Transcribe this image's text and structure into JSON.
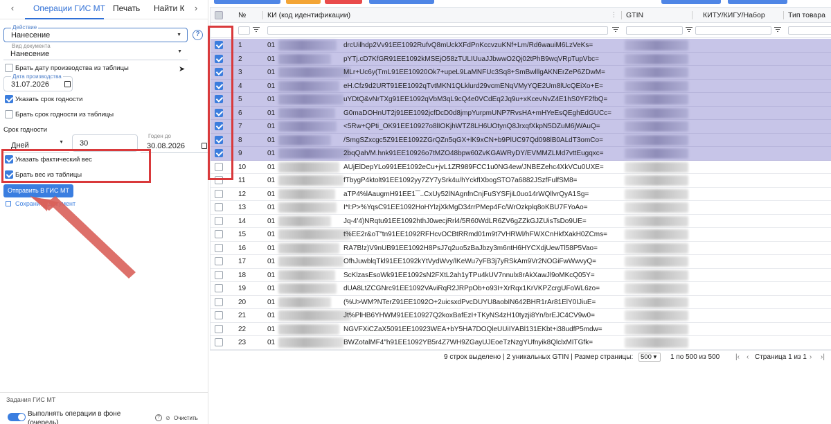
{
  "tabs": {
    "left_arrow": "‹",
    "items": [
      {
        "label": "Операции ГИС МТ",
        "active": true
      },
      {
        "label": "Печать",
        "active": false
      },
      {
        "label": "Найти КМ",
        "active": false
      }
    ],
    "right_arrow": "›"
  },
  "form": {
    "action_label": "Действие",
    "action_value": "Нанесение",
    "doc_type_label": "Вид документа",
    "doc_type_value": "Нанесение",
    "prod_date_from_table": "Брать дату производства из таблицы",
    "prod_date_label": "Дата производства",
    "prod_date_value": "31.07.2026",
    "expiry_specify": "Указать срок годности",
    "expiry_from_table": "Брать срок годности из таблицы",
    "expiry_section": "Срок годности",
    "expiry_unit": "Дней",
    "expiry_amount": "30",
    "valid_until_label": "Годен до",
    "valid_until_value": "30.08.2026",
    "actual_weight": "Указать фактический вес",
    "weight_from_table": "Брать вес из таблицы",
    "send_button": "Отправить В ГИС МТ",
    "save_button": "Сохранить Документ"
  },
  "tasks": {
    "title": "Задания ГИС МТ",
    "background_ops": "Выполнять операции в фоне (очередь)",
    "clear": "Очистить"
  },
  "grid": {
    "headers": {
      "num": "№",
      "ki": "КИ (код идентификации)",
      "gtin": "GTIN",
      "kitu": "КИТУ/КИГУ/Набор",
      "type": "Тип товара"
    },
    "rows": [
      {
        "n": "1",
        "pre": "01",
        "tail": "drcUilhdp2Vv91EE1092RufvQ8mUckXFdPnKccvzuKNf+Lm/Rd6wauiM6LzVeKs=",
        "sel": true
      },
      {
        "n": "2",
        "pre": "01",
        "tail": "pYTj.cD7KfGR91EE1092kMSEjO58zTULIUuaJJbwwO2Qj02tPhB9wqVRpTupVbc=",
        "sel": true
      },
      {
        "n": "3",
        "pre": "01",
        "tail": "MLr+Uc6y(TmL91EE10920Ok7+upeL9LaMNFUc3Sq8+SmBwlllgAKNErZeP6ZDwM=",
        "sel": true
      },
      {
        "n": "4",
        "pre": "01",
        "tail": "eH.Cfz9d2URT91EE1092qTvtMKN1QLklurd29vcmENqVMyYQE2Um8lUcQEiXo+E=",
        "sel": true
      },
      {
        "n": "5",
        "pre": "01",
        "tail": "uYDtQ&vNrTXg91EE1092qVbM3qL9cQ4e0VCdEq2Jq9u+xKcevNvZ4E1hS0YF2fbQ=",
        "sel": true
      },
      {
        "n": "6",
        "pre": "01",
        "tail": "G0maDOHnUT2j91EE1092jcfDcD0d8jmpYurpmUNP7RvsHA+mHYeEsQEghEdGUCc=",
        "sel": true
      },
      {
        "n": "7",
        "pre": "01",
        "tail": "<5Rw+QPti_OK91EE10927o8lIOKjhWTZ8LH6UOtynQ8JrxqfXkpN5DZuM6jWAuQ=",
        "sel": true
      },
      {
        "n": "8",
        "pre": "01",
        "tail": "/SmgSZxcgc5Z91EE1092ZGrQZn5qGX+lK9xCN+b9PlUC97Qd098lB0ALdT3omCo=",
        "sel": true
      },
      {
        "n": "9",
        "pre": "01",
        "tail": "2bqQah/M.hnk91EE10926o7tMZO48bpw60ZvKGAWRyDY/EVMMZLMd7vttEugqxc=",
        "sel": true
      },
      {
        "n": "10",
        "pre": "01",
        "tail": "AUjElDepYLo991EE1092eCu+jvL1ZR989FCC1u0NG4ew/JNBEZehc4XkVCu0UXE=",
        "sel": false
      },
      {
        "n": "11",
        "pre": "01",
        "tail": "fTbygP4ktolt91EE1092yy7ZY7ySrk4u/hYckfIXbogSTO7a6882JSzfFulfSM8=",
        "sel": false
      },
      {
        "n": "12",
        "pre": "01",
        "tail": "aTP4%lAaugmH91EE1‾‾..CxUy52lNAgnfnCnjFuSYSFjiL0uo14rWQllvrQyA1Sg=",
        "sel": false
      },
      {
        "n": "13",
        "pre": "01",
        "tail": "I*I:P>%YqsC91EE1092HoHYlzjXkMgD34rrPMep4Fc/WrOzkplq8oKBU7FYoAo=",
        "sel": false
      },
      {
        "n": "14",
        "pre": "01",
        "tail": "Jq-4'4)NRqtu91EE1092hthJ0wecjRrl4/5R60WdLR6ZV6gZZkGJZUisTsDo9UE=",
        "sel": false
      },
      {
        "n": "15",
        "pre": "01",
        "tail": "t%EE2r&oT\"tn91EE1092RFHcvOCBtRRmd01m9t7VHRWl/hFWXCnHkfXakH0ZCms=",
        "sel": false
      },
      {
        "n": "16",
        "pre": "01",
        "tail": "RA7B!z)V9nUB91EE1092H8PsJ7q2uo5zBaJbzy3m6ntH6HYCXdjUewTl58P5Vao=",
        "sel": false
      },
      {
        "n": "17",
        "pre": "01",
        "tail": "OfhJuwblqTkl91EE1092kYtVydWvy/lKeWu7yFB3j7yRSkAm9Vr2NOGiFwWwvyQ=",
        "sel": false
      },
      {
        "n": "18",
        "pre": "01",
        "tail": "ScKlzasEsoWk91EE1092sN2FXtL2ah1yTPu4kUV7nnulx8rAkXawJl9oMKcQ05Y=",
        "sel": false
      },
      {
        "n": "19",
        "pre": "01",
        "tail": "dUA8LtZCGNrc91EE1092VAviRqR2JRPpOb+o93I+XrRqx1KrVKPZcrgUFoWL6zo=",
        "sel": false
      },
      {
        "n": "20",
        "pre": "01",
        "tail": "(%U>WM?NTerZ91EE1092O+2uicsxdPvcDUYU8aobIN642BHR1rAr81ElY0IJiuE=",
        "sel": false
      },
      {
        "n": "21",
        "pre": "01",
        "tail": "Jt%PlHB6YHWM91EE10927Q2koxBafEzI+TKyNS4zH10tyzji8Yn/brEJC4CV9w0=",
        "sel": false
      },
      {
        "n": "22",
        "pre": "01",
        "tail": "NGVFXiCZaX5091EE10923WEA+bY5HA7DOQleUUiIYABl131EKbt+i38udfP5mdw=",
        "sel": false
      },
      {
        "n": "23",
        "pre": "01",
        "tail": "BWZotalMF4\"h91EE1092YB5r4Z7WH9ZGayUJEoeTzNzgYUfnyik8QlclxMITGfk=",
        "sel": false
      }
    ]
  },
  "footer": {
    "selected": "9 строк выделено | 2 уникальных GTIN | Размер страницы:",
    "page_size": "500",
    "range": "1 по 500 из 500",
    "page": "Страница 1 из 1"
  },
  "colors": {
    "accent": "#3a7ee0",
    "selected_row": "#c7c5e8",
    "highlight": "#d9393b"
  }
}
